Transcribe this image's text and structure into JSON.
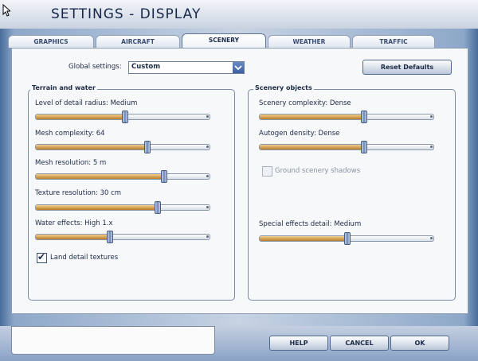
{
  "header": {
    "title": "SETTINGS - DISPLAY"
  },
  "tabs": [
    {
      "label": "GRAPHICS",
      "active": false
    },
    {
      "label": "AIRCRAFT",
      "active": false
    },
    {
      "label": "SCENERY",
      "active": true
    },
    {
      "label": "WEATHER",
      "active": false
    },
    {
      "label": "TRAFFIC",
      "active": false
    }
  ],
  "global": {
    "label": "Global settings:",
    "value": "Custom",
    "reset": "Reset Defaults"
  },
  "terrain": {
    "title": "Terrain and water",
    "sliders": [
      {
        "label": "Level of detail radius: Medium",
        "level": 0.51
      },
      {
        "label": "Mesh complexity: 64",
        "level": 0.64
      },
      {
        "label": "Mesh resolution: 5 m",
        "level": 0.74
      },
      {
        "label": "Texture resolution: 30 cm",
        "level": 0.7
      },
      {
        "label": "Water effects: High 1.x",
        "level": 0.42
      }
    ],
    "checkbox": {
      "label": "Land detail textures",
      "checked": true
    }
  },
  "scenery": {
    "title": "Scenery objects",
    "sliders": [
      {
        "label": "Scenery complexity: Dense",
        "level": 0.6
      },
      {
        "label": "Autogen density: Dense",
        "level": 0.6
      },
      {
        "label": "Special effects detail: Medium",
        "level": 0.5
      }
    ],
    "checkbox": {
      "label": "Ground scenery shadows",
      "checked": false
    }
  },
  "buttons": {
    "help": "HELP",
    "cancel": "CANCEL",
    "ok": "OK"
  },
  "colors": {
    "accent": "#3d5f9e",
    "fill": "#c98a35",
    "frame": "#8ea8c9"
  }
}
